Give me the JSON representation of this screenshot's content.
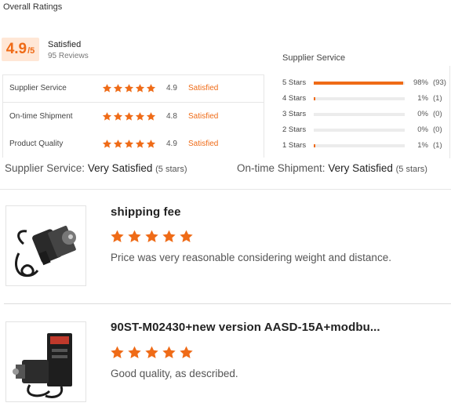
{
  "header": {
    "title": "Overall Ratings"
  },
  "overall": {
    "score": "4.9",
    "score_suffix": "/5",
    "label": "Satisfied",
    "reviews": "95 Reviews"
  },
  "ratings": [
    {
      "label": "Supplier Service",
      "score": "4.9",
      "text": "Satisfied",
      "stars": 5
    },
    {
      "label": "On-time Shipment",
      "score": "4.8",
      "text": "Satisfied",
      "stars": 5
    },
    {
      "label": "Product Quality",
      "score": "4.9",
      "text": "Satisfied",
      "stars": 5
    }
  ],
  "histogram": {
    "title": "Supplier Service",
    "rows": [
      {
        "label": "5 Stars",
        "pct_label": "98%",
        "count": "(93)",
        "fraction": 0.98
      },
      {
        "label": "4 Stars",
        "pct_label": "1%",
        "count": "(1)",
        "fraction": 0.01
      },
      {
        "label": "3 Stars",
        "pct_label": "0%",
        "count": "(0)",
        "fraction": 0.0
      },
      {
        "label": "2 Stars",
        "pct_label": "0%",
        "count": "(0)",
        "fraction": 0.0
      },
      {
        "label": "1 Stars",
        "pct_label": "1%",
        "count": "(1)",
        "fraction": 0.01
      }
    ]
  },
  "summary": {
    "supplier": {
      "label": "Supplier Service:",
      "value": "Very Satisfied",
      "stars": "(5 stars)"
    },
    "shipment": {
      "label": "On-time Shipment:",
      "value": "Very Satisfied",
      "stars": "(5 stars)"
    }
  },
  "reviews": [
    {
      "title": "shipping fee",
      "stars": 5,
      "text": "Price was very reasonable considering weight and distance.",
      "image_icon": "servo-motor-icon"
    },
    {
      "title": "90ST-M02430+new version AASD-15A+modbu...",
      "stars": 5,
      "text": "Good quality, as described.",
      "image_icon": "servo-drive-kit-icon"
    }
  ],
  "colors": {
    "accent": "#ef6b17",
    "score_bg": "#ffe7d6",
    "divider": "#e6e6e6"
  }
}
